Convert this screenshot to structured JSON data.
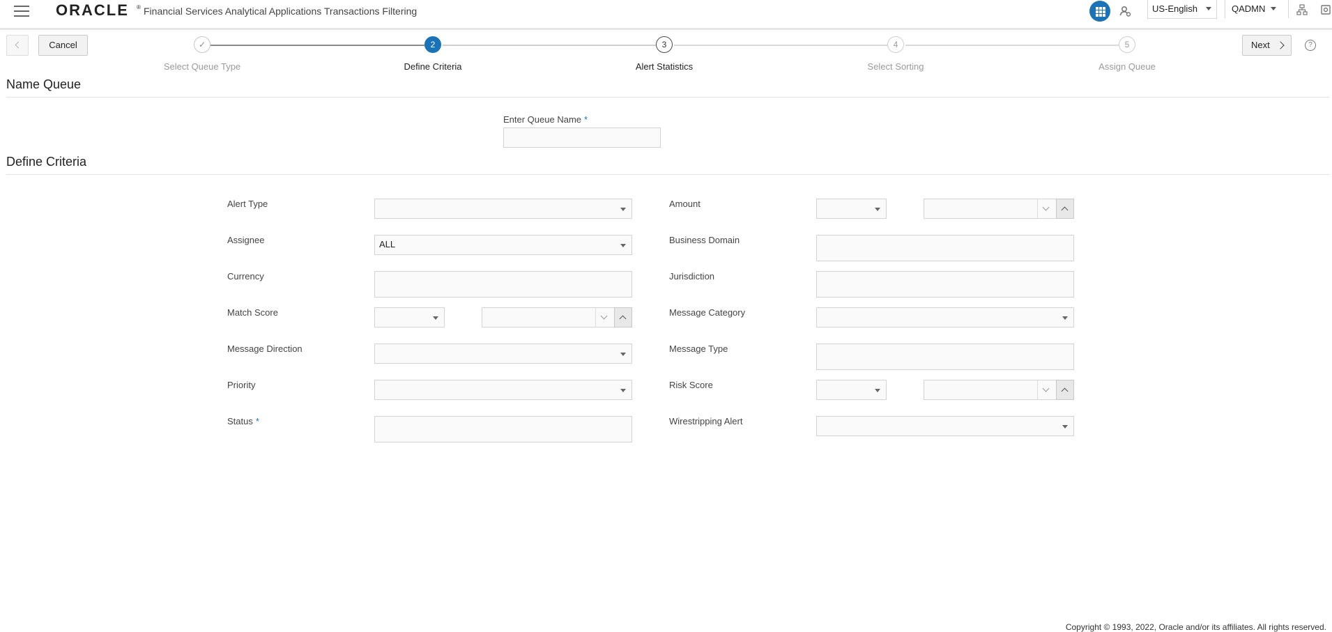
{
  "header": {
    "logo": "ORACLE",
    "logo_mark": "®",
    "app_title": "Financial Services Analytical Applications Transactions Filtering",
    "language": "US-English",
    "user": "QADMN",
    "accent_color": "#1a73b8"
  },
  "wizard": {
    "cancel_label": "Cancel",
    "next_label": "Next",
    "help_glyph": "?",
    "steps": [
      {
        "number": "✓",
        "label": "Select Queue Type",
        "state": "completed"
      },
      {
        "number": "2",
        "label": "Define Criteria",
        "state": "current"
      },
      {
        "number": "3",
        "label": "Alert Statistics",
        "state": "next"
      },
      {
        "number": "4",
        "label": "Select Sorting",
        "state": "pending"
      },
      {
        "number": "5",
        "label": "Assign Queue",
        "state": "pending"
      }
    ]
  },
  "name_queue": {
    "title": "Name Queue",
    "queue_name_label": "Enter Queue Name",
    "required_mark": "*",
    "queue_name_value": ""
  },
  "criteria": {
    "title": "Define Criteria",
    "alert_type": "Alert Type",
    "assignee": "Assignee",
    "assignee_value": "ALL",
    "currency": "Currency",
    "match_score": "Match Score",
    "message_direction": "Message Direction",
    "priority": "Priority",
    "status": "Status",
    "status_required": "*",
    "amount": "Amount",
    "business_domain": "Business Domain",
    "jurisdiction": "Jurisdiction",
    "message_category": "Message Category",
    "message_type": "Message Type",
    "risk_score": "Risk Score",
    "wirestripping_alert": "Wirestripping Alert"
  },
  "footer": {
    "copyright": "Copyright © 1993, 2022, Oracle and/or its affiliates. All rights reserved."
  }
}
